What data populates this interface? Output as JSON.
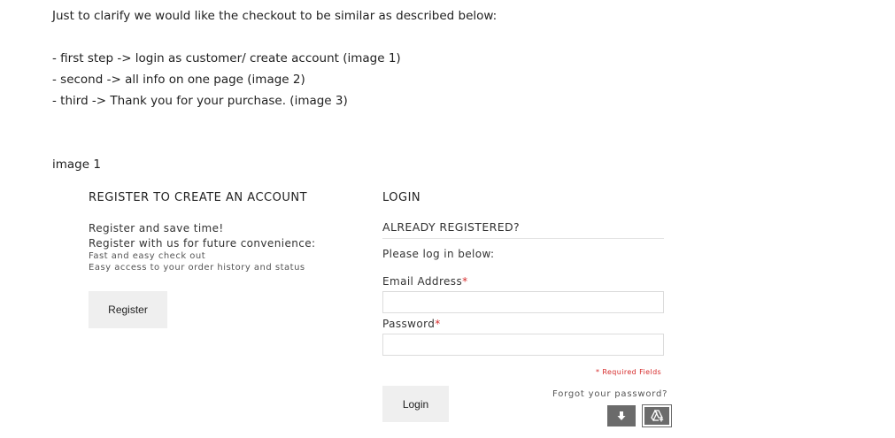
{
  "intro": {
    "line1": "Just to clarify we would like the checkout to be similar as described below:",
    "steps": [
      "- first step -> login as customer/ create account (image 1)",
      "- second -> all info on one page (image 2)",
      "- third -> Thank you for your purchase. (image 3)"
    ],
    "image_label": "image 1"
  },
  "register": {
    "title": "REGISTER TO CREATE AN ACCOUNT",
    "subtitle": "Register and save time!",
    "line": "Register with us for future convenience:",
    "bullet1": "Fast and easy check out",
    "bullet2": "Easy access to your order history and status",
    "button": "Register"
  },
  "login": {
    "title": "LOGIN",
    "subtitle": "ALREADY REGISTERED?",
    "prompt": "Please log in below:",
    "email_label": "Email Address",
    "password_label": "Password",
    "asterisk": "*",
    "required_note": "* Required Fields",
    "forgot": "Forgot your password?",
    "button": "Login"
  },
  "colors": {
    "accent_red": "#d62b2b",
    "button_bg": "#efefef",
    "icon_bg": "#6b6b6b"
  },
  "icons": [
    "download-icon",
    "add-to-drive-icon"
  ]
}
